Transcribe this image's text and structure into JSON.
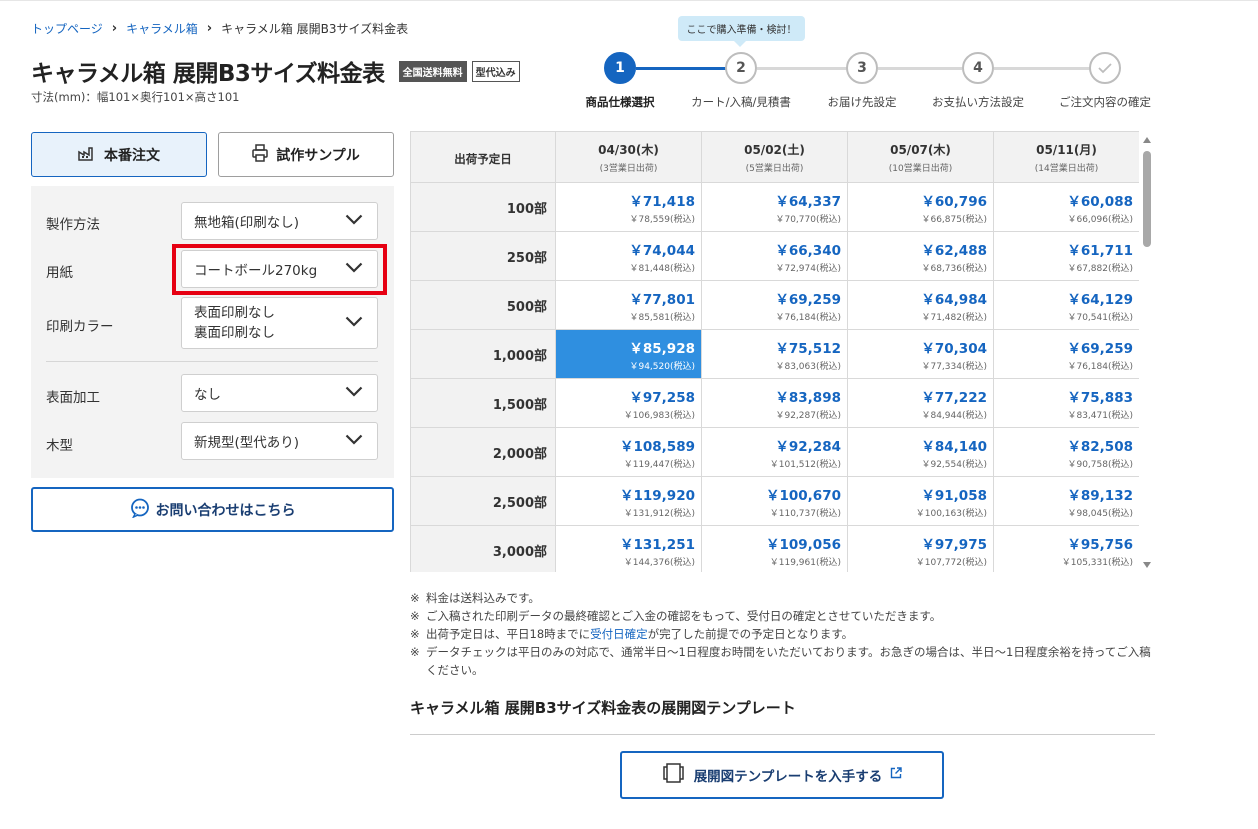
{
  "breadcrumb": {
    "items": [
      "トップページ",
      "キャラメル箱"
    ],
    "current": "キャラメル箱 展開B3サイズ料金表"
  },
  "title": "キャラメル箱 展開B3サイズ料金表",
  "badges": {
    "shipping": "全国送料無料",
    "die": "型代込み"
  },
  "dimensions": "寸法(mm)：幅101×奥行101×高さ101",
  "stepper": {
    "tooltip": "ここで購入準備・検討！",
    "steps": [
      {
        "num": "1",
        "label": "商品仕様選択",
        "active": true
      },
      {
        "num": "2",
        "label": "カート/入稿/見積書"
      },
      {
        "num": "3",
        "label": "お届け先設定"
      },
      {
        "num": "4",
        "label": "お支払い方法設定"
      },
      {
        "num": "✓",
        "label": "ご注文内容の確定"
      }
    ]
  },
  "order_tabs": {
    "production": "本番注文",
    "sample": "試作サンプル"
  },
  "form": {
    "method": {
      "label": "製作方法",
      "value": "無地箱(印刷なし)"
    },
    "paper": {
      "label": "用紙",
      "value": "コートボール270kg"
    },
    "color": {
      "label": "印刷カラー",
      "value_line1": "表面印刷なし",
      "value_line2": "裏面印刷なし"
    },
    "finish": {
      "label": "表面加工",
      "value": "なし"
    },
    "die": {
      "label": "木型",
      "value": "新規型(型代あり)"
    }
  },
  "contact_label": "お問い合わせはこちら",
  "table": {
    "ship_header": "出荷予定日",
    "dates": [
      {
        "date": "04/30(木)",
        "note": "(3営業日出荷)"
      },
      {
        "date": "05/02(土)",
        "note": "(5営業日出荷)"
      },
      {
        "date": "05/07(木)",
        "note": "(10営業日出荷)"
      },
      {
        "date": "05/11(月)",
        "note": "(14営業日出荷)"
      }
    ],
    "rows": [
      {
        "qty": "100部",
        "prices": [
          [
            "￥71,418",
            "￥78,559(税込)"
          ],
          [
            "￥64,337",
            "￥70,770(税込)"
          ],
          [
            "￥60,796",
            "￥66,875(税込)"
          ],
          [
            "￥60,088",
            "￥66,096(税込)"
          ]
        ]
      },
      {
        "qty": "250部",
        "prices": [
          [
            "￥74,044",
            "￥81,448(税込)"
          ],
          [
            "￥66,340",
            "￥72,974(税込)"
          ],
          [
            "￥62,488",
            "￥68,736(税込)"
          ],
          [
            "￥61,711",
            "￥67,882(税込)"
          ]
        ]
      },
      {
        "qty": "500部",
        "prices": [
          [
            "￥77,801",
            "￥85,581(税込)"
          ],
          [
            "￥69,259",
            "￥76,184(税込)"
          ],
          [
            "￥64,984",
            "￥71,482(税込)"
          ],
          [
            "￥64,129",
            "￥70,541(税込)"
          ]
        ]
      },
      {
        "qty": "1,000部",
        "prices": [
          [
            "￥85,928",
            "￥94,520(税込)"
          ],
          [
            "￥75,512",
            "￥83,063(税込)"
          ],
          [
            "￥70,304",
            "￥77,334(税込)"
          ],
          [
            "￥69,259",
            "￥76,184(税込)"
          ]
        ]
      },
      {
        "qty": "1,500部",
        "prices": [
          [
            "￥97,258",
            "￥106,983(税込)"
          ],
          [
            "￥83,898",
            "￥92,287(税込)"
          ],
          [
            "￥77,222",
            "￥84,944(税込)"
          ],
          [
            "￥75,883",
            "￥83,471(税込)"
          ]
        ]
      },
      {
        "qty": "2,000部",
        "prices": [
          [
            "￥108,589",
            "￥119,447(税込)"
          ],
          [
            "￥92,284",
            "￥101,512(税込)"
          ],
          [
            "￥84,140",
            "￥92,554(税込)"
          ],
          [
            "￥82,508",
            "￥90,758(税込)"
          ]
        ]
      },
      {
        "qty": "2,500部",
        "prices": [
          [
            "￥119,920",
            "￥131,912(税込)"
          ],
          [
            "￥100,670",
            "￥110,737(税込)"
          ],
          [
            "￥91,058",
            "￥100,163(税込)"
          ],
          [
            "￥89,132",
            "￥98,045(税込)"
          ]
        ]
      },
      {
        "qty": "3,000部",
        "prices": [
          [
            "￥131,251",
            "￥144,376(税込)"
          ],
          [
            "￥109,056",
            "￥119,961(税込)"
          ],
          [
            "￥97,975",
            "￥107,772(税込)"
          ],
          [
            "￥95,756",
            "￥105,331(税込)"
          ]
        ]
      }
    ]
  },
  "notes": {
    "mark": "※",
    "n1": "料金は送料込みです。",
    "n2": "ご入稿された印刷データの最終確認とご入金の確認をもって、受付日の確定とさせていただきます。",
    "n3_before": "出荷予定日は、平日18時までに",
    "n3_link": "受付日確定",
    "n3_after": "が完了した前提での予定日となります。",
    "n4": "データチェックは平日のみの対応で、通常半日〜1日程度お時間をいただいております。お急ぎの場合は、半日〜1日程度余裕を持ってご入稿ください。"
  },
  "template_section_title": "キャラメル箱 展開B3サイズ料金表の展開図テンプレート",
  "template_button": "展開図テンプレートを入手する",
  "colors": {
    "accent": "#1565c0",
    "selected_cell": "#2f8fe0",
    "highlight": "#e60012"
  }
}
